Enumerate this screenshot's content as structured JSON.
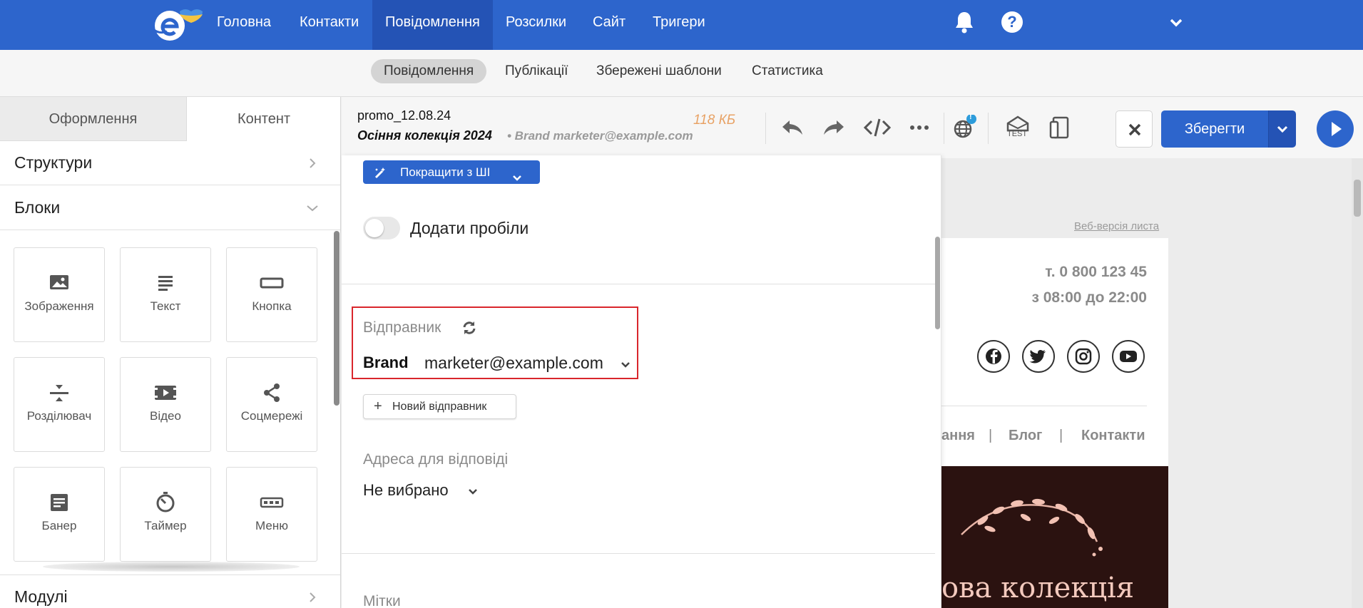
{
  "topnav": {
    "items": [
      "Головна",
      "Контакти",
      "Повідомлення",
      "Розсилки",
      "Сайт",
      "Тригери"
    ],
    "active_index": 2,
    "help_glyph": "?"
  },
  "subnav": {
    "items": [
      "Повідомлення",
      "Публікації",
      "Збережені шаблони",
      "Статистика"
    ],
    "active_index": 0
  },
  "left_panel": {
    "tabs": [
      "Оформлення",
      "Контент"
    ],
    "sections": {
      "structures": "Структури",
      "blocks": "Блоки",
      "modules": "Модулі"
    },
    "blocks": [
      {
        "label": "Зображення",
        "icon": "image-icon"
      },
      {
        "label": "Текст",
        "icon": "text-icon"
      },
      {
        "label": "Кнопка",
        "icon": "button-icon"
      },
      {
        "label": "Розділювач",
        "icon": "divider-icon"
      },
      {
        "label": "Відео",
        "icon": "video-icon"
      },
      {
        "label": "Соцмережі",
        "icon": "share-icon"
      },
      {
        "label": "Банер",
        "icon": "banner-icon"
      },
      {
        "label": "Таймер",
        "icon": "timer-icon"
      },
      {
        "label": "Меню",
        "icon": "menu-icon"
      }
    ]
  },
  "editor_header": {
    "file_name": "promo_12.08.24",
    "subject": "Осіння колекція 2024",
    "from": "• Brand marketer@example.com",
    "size": "118 КБ",
    "test_label": "TEST",
    "save_label": "Зберегти",
    "badge": "!"
  },
  "settings": {
    "ai_button": "Покращити з ШІ",
    "add_spaces": "Додати пробіли",
    "sender_label": "Відправник",
    "sender_name": "Brand",
    "sender_email": "marketer@example.com",
    "new_sender": "Новий відправник",
    "new_sender_plus": "+",
    "reply_label": "Адреса для відповіді",
    "reply_value": "Не вибрано",
    "tags_label": "Мітки"
  },
  "preview": {
    "web_version": "Веб-версія листа",
    "phone": "т. 0 800 123 45",
    "hours": "з 08:00 до 22:00",
    "menu_items": [
      "ання",
      "|",
      "Блог",
      "|",
      "Контакти"
    ],
    "banner_text": "ова колекція",
    "social_icons": [
      "facebook-icon",
      "twitter-icon",
      "instagram-icon",
      "youtube-icon"
    ]
  },
  "colors": {
    "brand_blue": "#2d65cc",
    "highlight_red": "#d9262c",
    "size_orange": "#e8a265"
  }
}
